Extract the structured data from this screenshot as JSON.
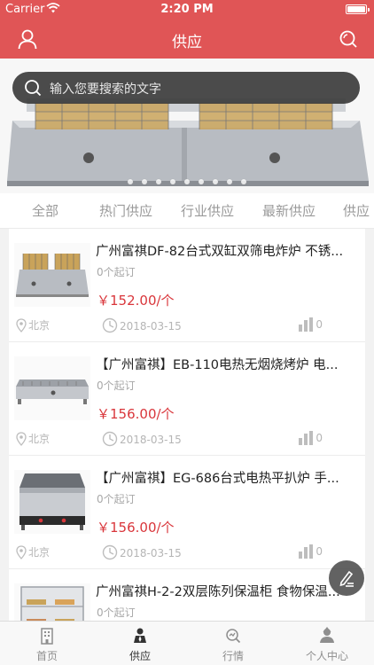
{
  "status_bar": {
    "carrier": "Carrier",
    "time": "2:20 PM"
  },
  "nav": {
    "title": "供应"
  },
  "search": {
    "placeholder": "输入您要搜索的文字"
  },
  "banner": {
    "dot_count": 9,
    "active_dot": 0
  },
  "tabs": [
    "全部",
    "热门供应",
    "行业供应",
    "最新供应",
    "供应"
  ],
  "items": [
    {
      "name": "广州富祺DF-82台式双缸双筛电炸炉 不锈...",
      "moq": "0个起订",
      "price": "￥152.00/个",
      "location": "北京",
      "date": "2018-03-15",
      "views": "0"
    },
    {
      "name": "【广州富祺】EB-110电热无烟烧烤炉  电...",
      "moq": "0个起订",
      "price": "￥156.00/个",
      "location": "北京",
      "date": "2018-03-15",
      "views": "0"
    },
    {
      "name": "【广州富祺】EG-686台式电热平扒炉 手...",
      "moq": "0个起订",
      "price": "￥156.00/个",
      "location": "北京",
      "date": "2018-03-15",
      "views": "0"
    },
    {
      "name": "广州富祺H-2-2双层陈列保温柜 食物保温...",
      "moq": "0个起订",
      "price": "",
      "location": "",
      "date": "",
      "views": ""
    }
  ],
  "tab_bar": [
    {
      "label": "首页",
      "icon": "building-icon"
    },
    {
      "label": "供应",
      "icon": "person-icon"
    },
    {
      "label": "行情",
      "icon": "market-icon"
    },
    {
      "label": "个人中心",
      "icon": "profile-icon"
    }
  ],
  "colors": {
    "brand_red": "#e05556",
    "price_red": "#d9363b",
    "muted": "#b5b5b5"
  }
}
